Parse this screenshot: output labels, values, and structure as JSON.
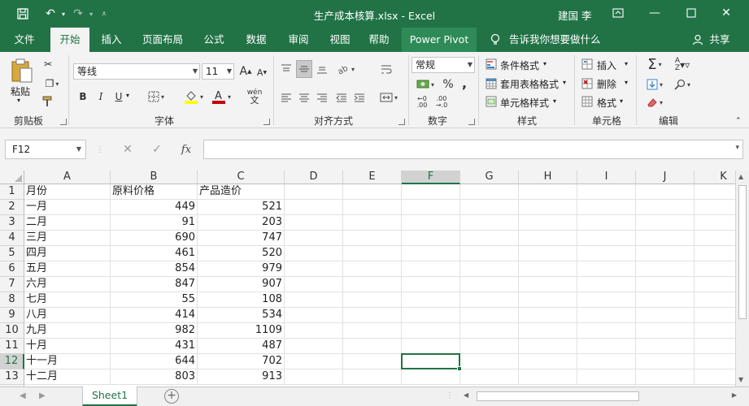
{
  "titlebar": {
    "title": "生产成本核算.xlsx  -  Excel",
    "user": "建国 李",
    "icons": [
      "save-icon",
      "undo-icon",
      "redo-icon",
      "customize-qat-icon",
      "ribbon-display-icon",
      "minimize-icon",
      "maximize-icon",
      "close-icon"
    ]
  },
  "menu": {
    "tabs": [
      "文件",
      "开始",
      "插入",
      "页面布局",
      "公式",
      "数据",
      "审阅",
      "视图",
      "帮助",
      "Power Pivot"
    ],
    "active": "开始",
    "tell_me": "告诉我你想要做什么",
    "share": "共享"
  },
  "ribbon": {
    "clipboard": {
      "label": "剪贴板",
      "paste": "粘贴"
    },
    "font": {
      "label": "字体",
      "name": "等线",
      "size": "11",
      "bold": "B",
      "italic": "I",
      "underline": "U",
      "increase": "A",
      "decrease": "A",
      "phonetic": "wén"
    },
    "alignment": {
      "label": "对齐方式"
    },
    "number": {
      "label": "数字",
      "format": "常规",
      "percent": "%",
      "comma": ","
    },
    "styles": {
      "label": "样式",
      "conditional": "条件格式",
      "table": "套用表格格式",
      "cell_styles": "单元格样式"
    },
    "cells": {
      "label": "单元格",
      "insert": "插入",
      "delete": "删除",
      "format": "格式"
    },
    "editing": {
      "label": "编辑"
    },
    "accent_color": "#217346",
    "fill_color": "#ffff00",
    "font_color": "#c00000"
  },
  "formula_bar": {
    "name_box": "F12",
    "formula": ""
  },
  "grid": {
    "columns": [
      "A",
      "B",
      "C",
      "D",
      "E",
      "F",
      "G",
      "H",
      "I",
      "J",
      "K"
    ],
    "selected_column": "F",
    "selected_row": "12",
    "rows": [
      {
        "n": "1",
        "a": "月份",
        "b": "原料价格",
        "c": "产品造价"
      },
      {
        "n": "2",
        "a": "一月",
        "b": "449",
        "c": "521"
      },
      {
        "n": "3",
        "a": "二月",
        "b": "91",
        "c": "203"
      },
      {
        "n": "4",
        "a": "三月",
        "b": "690",
        "c": "747"
      },
      {
        "n": "5",
        "a": "四月",
        "b": "461",
        "c": "520"
      },
      {
        "n": "6",
        "a": "五月",
        "b": "854",
        "c": "979"
      },
      {
        "n": "7",
        "a": "六月",
        "b": "847",
        "c": "907"
      },
      {
        "n": "8",
        "a": "七月",
        "b": "55",
        "c": "108"
      },
      {
        "n": "9",
        "a": "八月",
        "b": "414",
        "c": "534"
      },
      {
        "n": "10",
        "a": "九月",
        "b": "982",
        "c": "1109"
      },
      {
        "n": "11",
        "a": "十月",
        "b": "431",
        "c": "487"
      },
      {
        "n": "12",
        "a": "十一月",
        "b": "644",
        "c": "702"
      },
      {
        "n": "13",
        "a": "十二月",
        "b": "803",
        "c": "913"
      }
    ]
  },
  "sheets": {
    "tabs": [
      "Sheet1"
    ],
    "active": "Sheet1"
  }
}
